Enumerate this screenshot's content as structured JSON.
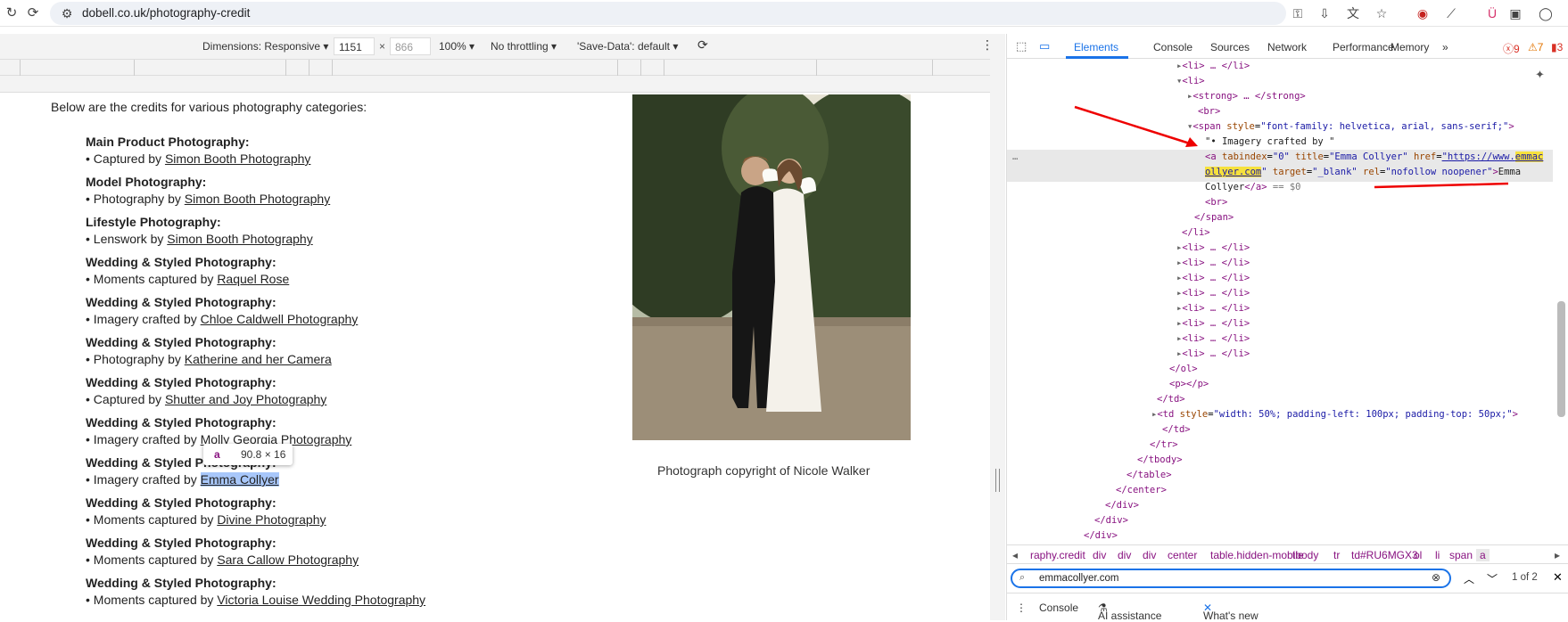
{
  "browser": {
    "url": "dobell.co.uk/photography-credit"
  },
  "device_toolbar": {
    "dimensions_label": "Dimensions: Responsive",
    "width": "1151",
    "height": "866",
    "zoom": "100%",
    "throttling": "No throttling",
    "save_data": "'Save-Data': default"
  },
  "page": {
    "intro": "Below are the credits for various photography categories:",
    "credits": [
      {
        "heading": "Main Product Photography:",
        "prefix": "• Captured by ",
        "link": "Simon Booth Photography"
      },
      {
        "heading": "Model Photography:",
        "prefix": "• Photography by ",
        "link": "Simon Booth Photography"
      },
      {
        "heading": "Lifestyle Photography:",
        "prefix": "• Lenswork by ",
        "link": "Simon Booth Photography"
      },
      {
        "heading": "Wedding & Styled Photography:",
        "prefix": "• Moments captured by ",
        "link": "Raquel Rose"
      },
      {
        "heading": "Wedding & Styled Photography:",
        "prefix": "• Imagery crafted by ",
        "link": "Chloe Caldwell Photography"
      },
      {
        "heading": "Wedding & Styled Photography:",
        "prefix": "• Photography by ",
        "link": "Katherine and her Camera"
      },
      {
        "heading": "Wedding & Styled Photography:",
        "prefix": "• Captured by ",
        "link": "Shutter and Joy Photography"
      },
      {
        "heading": "Wedding & Styled Photography:",
        "prefix": "• Imagery crafted by ",
        "link": "Molly Georgia Photography"
      },
      {
        "heading": "Wedding & Styled Photography:",
        "prefix": "• Imagery crafted by ",
        "link": "Emma Collyer"
      },
      {
        "heading": "Wedding & Styled Photography:",
        "prefix": "• Moments captured by ",
        "link": "Divine Photography"
      },
      {
        "heading": "Wedding & Styled Photography:",
        "prefix": "• Moments captured by ",
        "link": "Sara Callow Photography"
      },
      {
        "heading": "Wedding & Styled Photography:",
        "prefix": "• Moments captured by ",
        "link": "Victoria Louise Wedding Photography"
      }
    ],
    "caption": "Photograph copyright of Nicole Walker",
    "tooltip_tag": "a",
    "tooltip_dims": "90.8 × 16"
  },
  "devtools": {
    "tabs": [
      "Elements",
      "Console",
      "Sources",
      "Network",
      "Performance",
      "Memory"
    ],
    "errors": "9",
    "warnings": "7",
    "issues": "3",
    "breadcrumbs": [
      "raphy.credit",
      "div",
      "div",
      "div",
      "center",
      "table.hidden-mobile",
      "tbody",
      "tr",
      "td#RU6MGX3",
      "ol",
      "li",
      "span",
      "a"
    ],
    "search_query": "emmacollyer.com",
    "search_count": "1 of 2",
    "drawer_tabs": [
      "Console",
      "AI assistance",
      "What's new"
    ],
    "tree": {
      "li_collapsed": "<li> … </li>",
      "li_open": "<li>",
      "strong": "<strong> … </strong>",
      "br": "<br>",
      "span_open_tag": "<span ",
      "span_attr": "style",
      "span_val": "\"font-family: helvetica, arial, sans-serif;\"",
      "text_node": "\"• Imagery crafted by \"",
      "a_tag": "<a ",
      "a_tabindex": "tabindex",
      "a_tabindex_val": "\"0\"",
      "a_title": "title",
      "a_title_val": "\"Emma Collyer\"",
      "a_href": "href",
      "a_href_val1": "\"https://www.",
      "a_href_hl1": "emmac",
      "a_href_hl2": "ollyer.com",
      "a_target": "target",
      "a_target_val": "\"_blank\"",
      "a_rel": "rel",
      "a_rel_val": "\"nofollow noopener\"",
      "a_text": "Emma Collyer",
      "a_close": "</a>",
      "eq": "== $0",
      "span_close": "</span>",
      "li_close": "</li>",
      "ol_close": "</ol>",
      "p": "<p></p>",
      "td_close": "</td>",
      "td_open": "<td ",
      "td_attr": "style",
      "td_val": "\"width: 50%; padding-left: 100px; padding-top: 50px;\"",
      "tr_close": "</tr>",
      "tbody_close": "</tbody>",
      "table_close": "</table>",
      "center_close": "</center>",
      "div_close": "</div>"
    }
  }
}
